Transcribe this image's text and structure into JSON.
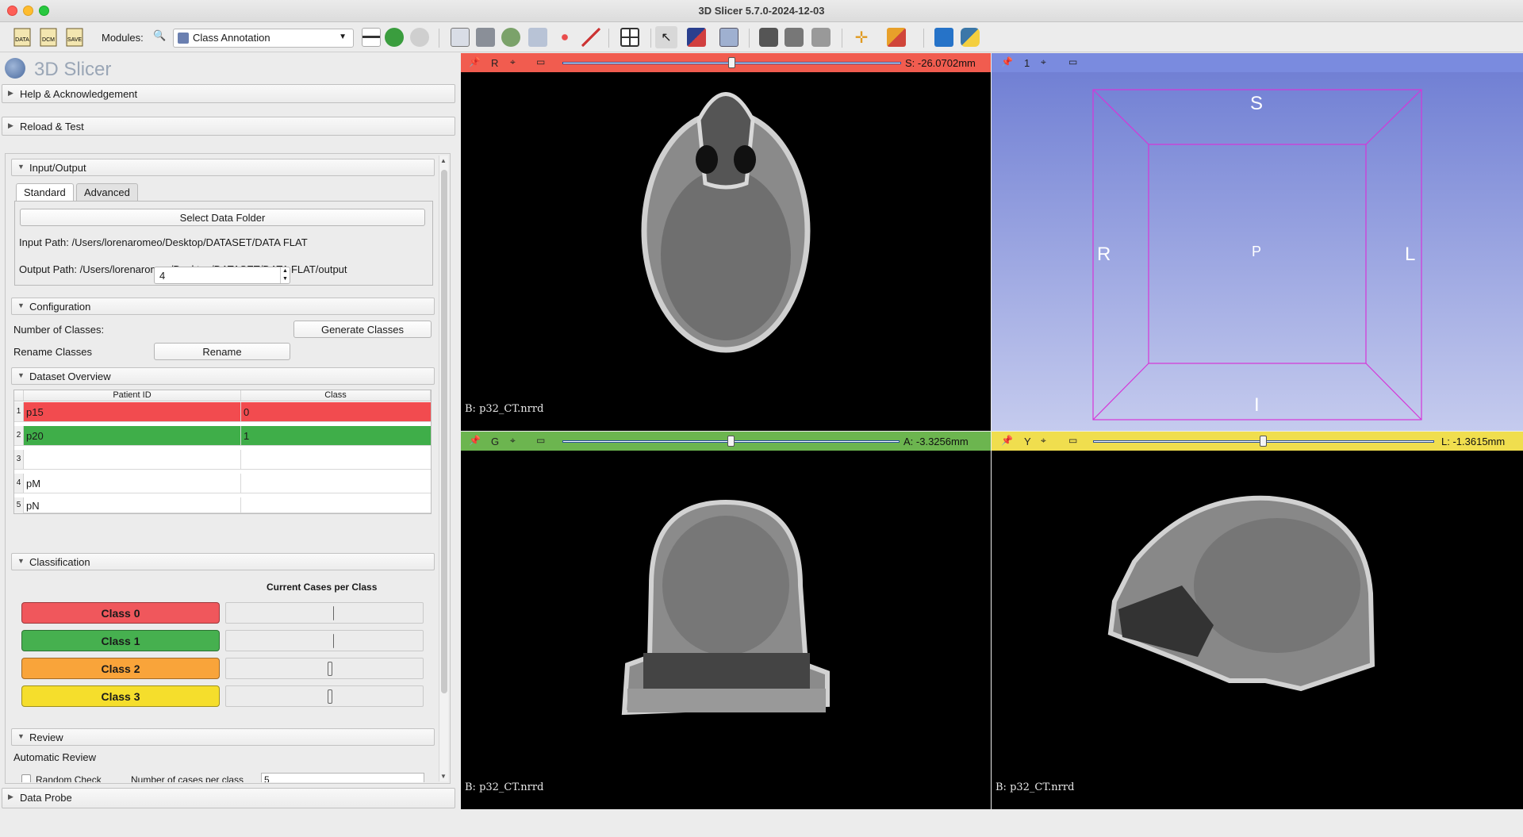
{
  "window": {
    "title": "3D Slicer 5.7.0-2024-12-03"
  },
  "toolbar": {
    "data_label": "DATA",
    "dcm_label": "DCM",
    "save_label": "SAVE",
    "modules_label": "Modules:",
    "module_selected": "Class Annotation"
  },
  "app": {
    "logo_text": "3D Slicer"
  },
  "panels": {
    "help": "Help & Acknowledgement",
    "reload": "Reload & Test",
    "data_probe": "Data Probe"
  },
  "io": {
    "section": "Input/Output",
    "tabs": [
      "Standard",
      "Advanced"
    ],
    "select_button": "Select Data Folder",
    "input_path": "Input Path: /Users/lorenaromeo/Desktop/DATASET/DATA FLAT",
    "output_path": "Output Path: /Users/lorenaromeo/Desktop/DATASET/DATA FLAT/output"
  },
  "config": {
    "section": "Configuration",
    "num_classes_label": "Number of Classes:",
    "num_classes_value": "4",
    "generate_button": "Generate Classes",
    "rename_label": "Rename Classes",
    "rename_button": "Rename"
  },
  "dataset": {
    "section": "Dataset Overview",
    "columns": [
      "Patient ID",
      "Class"
    ],
    "rows": [
      {
        "num": "1",
        "patient": "p15",
        "cls": "0"
      },
      {
        "num": "2",
        "patient": "p20",
        "cls": "1"
      },
      {
        "num": "3",
        "patient": "",
        "cls": ""
      },
      {
        "num": "4",
        "patient": "pM",
        "cls": ""
      },
      {
        "num": "5",
        "patient": "pN",
        "cls": ""
      }
    ]
  },
  "classification": {
    "section": "Classification",
    "cases_header": "Current Cases per Class",
    "classes": [
      {
        "label": "Class 0",
        "color": "#f0575c",
        "count": 1
      },
      {
        "label": "Class 1",
        "color": "#46b04f",
        "count": 1
      },
      {
        "label": "Class 2",
        "color": "#f9a43a",
        "count": 0
      },
      {
        "label": "Class 3",
        "color": "#f5de2c",
        "count": 0
      }
    ]
  },
  "review": {
    "section": "Review",
    "auto_label": "Automatic Review",
    "random_check": "Random Check",
    "cases_label": "Number of cases per class",
    "cases_value": "5"
  },
  "views": {
    "red": {
      "letter": "R",
      "value": "S: -26.0702mm",
      "caption": "B: p32_CT.nrrd",
      "color": "#f15c4f"
    },
    "threeD": {
      "letter": "1",
      "color": "#7a8bdf",
      "labels": {
        "top": "S",
        "left": "R",
        "right": "L",
        "center": "P",
        "bottom": "I"
      }
    },
    "green": {
      "letter": "G",
      "value": "A: -3.3256mm",
      "caption": "B: p32_CT.nrrd",
      "color": "#6cb54f"
    },
    "yellow": {
      "letter": "Y",
      "value": "L: -1.3615mm",
      "caption": "B: p32_CT.nrrd",
      "color": "#f0de4e"
    }
  },
  "slider_positions": {
    "red": 0.5,
    "green": 0.5,
    "yellow": 0.5
  }
}
